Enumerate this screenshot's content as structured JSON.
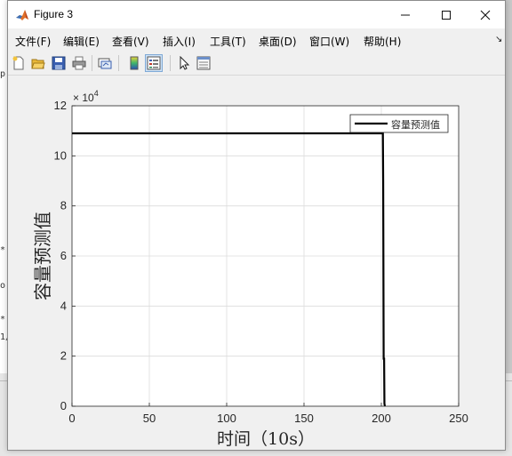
{
  "window": {
    "title": "Figure 3",
    "minimize_glyph": "─",
    "maximize_glyph": "☐",
    "close_glyph": "✕"
  },
  "menubar": {
    "items": [
      {
        "label": "文件(F)"
      },
      {
        "label": "编辑(E)"
      },
      {
        "label": "查看(V)"
      },
      {
        "label": "插入(I)"
      },
      {
        "label": "工具(T)"
      },
      {
        "label": "桌面(D)"
      },
      {
        "label": "窗口(W)"
      },
      {
        "label": "帮助(H)"
      }
    ],
    "dock_glyph": "↘"
  },
  "toolbar": {
    "buttons": [
      {
        "icon": "new-figure-icon"
      },
      {
        "icon": "open-file-icon"
      },
      {
        "icon": "save-icon"
      },
      {
        "icon": "print-icon"
      },
      {
        "icon": "link-plot-icon"
      },
      {
        "icon": "insert-colorbar-icon"
      },
      {
        "icon": "insert-legend-icon"
      },
      {
        "icon": "edit-plot-icon"
      },
      {
        "icon": "property-inspector-icon"
      }
    ]
  },
  "background": {
    "editor_chars": [
      "p",
      "*",
      "o",
      "*",
      "1/"
    ]
  },
  "chart_data": {
    "type": "line",
    "xlabel": "时间（10s）",
    "ylabel": "容量预测值",
    "exponent_label": "× 10",
    "exponent_power": "4",
    "xlim": [
      0,
      250
    ],
    "ylim": [
      0,
      120000
    ],
    "xticks": [
      "0",
      "50",
      "100",
      "150",
      "200",
      "250"
    ],
    "yticks": [
      "0",
      "2",
      "4",
      "6",
      "8",
      "10",
      "12"
    ],
    "grid": true,
    "legend_position": "top-right",
    "series": [
      {
        "name": "容量预测值",
        "color": "#000000",
        "x": [
          0,
          201,
          201.2,
          201.5,
          201.8,
          202,
          202.3
        ],
        "y": [
          109000,
          109000,
          90000,
          19000,
          19000,
          1000,
          0
        ]
      }
    ]
  }
}
